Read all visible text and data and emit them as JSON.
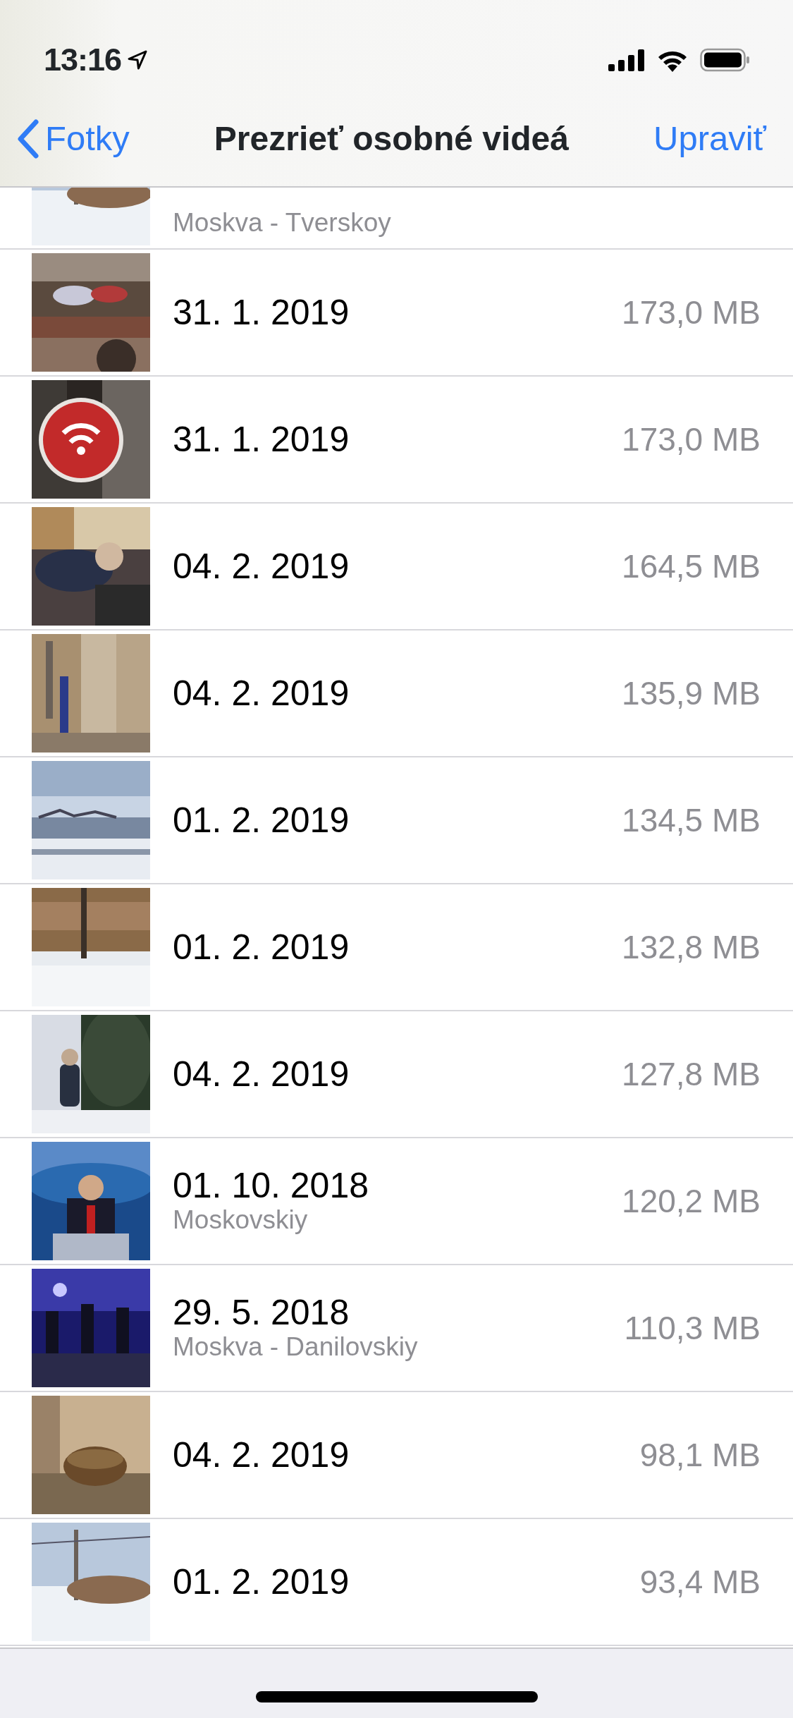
{
  "status_bar": {
    "time": "13:16"
  },
  "nav": {
    "back": "Fotky",
    "title": "Prezrieť osobné videá",
    "action": "Upraviť"
  },
  "videos": [
    {
      "kind": "picture",
      "place": "Moskva - Tverskoy",
      "clipped": true
    },
    {
      "kind": "picture",
      "date": "31. 1. 2019",
      "size": "173,0 MB"
    },
    {
      "kind": "picture",
      "date": "31. 1. 2019",
      "size": "173,0 MB"
    },
    {
      "kind": "picture",
      "date": "04. 2. 2019",
      "size": "164,5 MB"
    },
    {
      "kind": "picture",
      "date": "04. 2. 2019",
      "size": "135,9 MB"
    },
    {
      "kind": "picture",
      "date": "01. 2. 2019",
      "size": "134,5 MB"
    },
    {
      "kind": "picture",
      "date": "01. 2. 2019",
      "size": "132,8 MB"
    },
    {
      "kind": "picture",
      "date": "04. 2. 2019",
      "size": "127,8 MB"
    },
    {
      "kind": "picture",
      "date": "01. 10. 2018",
      "place": "Moskovskiy",
      "size": "120,2 MB"
    },
    {
      "kind": "picture",
      "date": "29. 5. 2018",
      "place": "Moskva - Danilovskiy",
      "size": "110,3 MB"
    },
    {
      "kind": "picture",
      "date": "04. 2. 2019",
      "size": "98,1 MB"
    },
    {
      "kind": "picture",
      "date": "01. 2. 2019",
      "size": "93,4 MB"
    }
  ]
}
